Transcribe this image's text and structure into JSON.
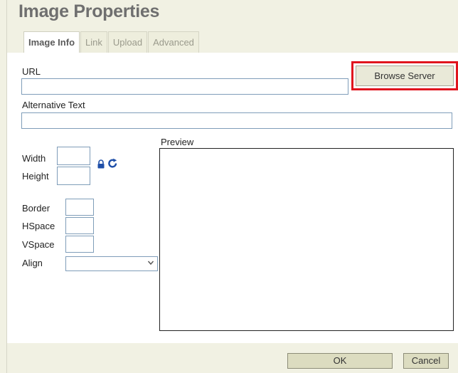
{
  "dialog": {
    "title": "Image Properties",
    "tabs": [
      {
        "label": "Image Info",
        "active": true
      },
      {
        "label": "Link",
        "active": false
      },
      {
        "label": "Upload",
        "active": false
      },
      {
        "label": "Advanced",
        "active": false
      }
    ]
  },
  "form": {
    "url_label": "URL",
    "url_value": "",
    "browse_label": "Browse Server",
    "alt_label": "Alternative Text",
    "alt_value": "",
    "width_label": "Width",
    "height_label": "Height",
    "border_label": "Border",
    "hspace_label": "HSpace",
    "vspace_label": "VSpace",
    "align_label": "Align",
    "align_value": "",
    "preview_label": "Preview"
  },
  "icons": {
    "lock": "lock-icon",
    "reset": "reset-size-icon"
  },
  "footer": {
    "ok_label": "OK",
    "cancel_label": "Cancel"
  },
  "colors": {
    "dialog_bg": "#f1f1e3",
    "highlight": "#e0141e",
    "icon_blue": "#1f4fa8"
  }
}
